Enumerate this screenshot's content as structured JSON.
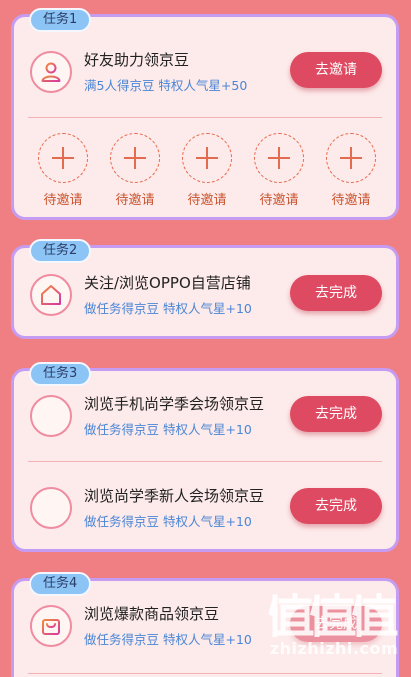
{
  "tasks": [
    {
      "tag": "任务1",
      "items": [
        {
          "title": "好友助力领京豆",
          "subtitle": "满5人得京豆 特权人气星+50",
          "button": "去邀请",
          "icon": "person-icon"
        }
      ],
      "invite_slots": [
        "待邀请",
        "待邀请",
        "待邀请",
        "待邀请",
        "待邀请"
      ]
    },
    {
      "tag": "任务2",
      "items": [
        {
          "title": "关注/浏览OPPO自营店铺",
          "subtitle": "做任务得京豆 特权人气星+10",
          "button": "去完成",
          "icon": "store-icon"
        }
      ]
    },
    {
      "tag": "任务3",
      "items": [
        {
          "title": "浏览手机尚学季会场领京豆",
          "subtitle": "做任务得京豆 特权人气星+10",
          "button": "去完成",
          "icon": "bars-icon"
        },
        {
          "title": "浏览尚学季新人会场领京豆",
          "subtitle": "做任务得京豆 特权人气星+10",
          "button": "去完成",
          "icon": "bars-icon"
        }
      ]
    },
    {
      "tag": "任务4",
      "items": [
        {
          "title": "浏览爆款商品领京豆",
          "subtitle": "做任务得京豆 特权人气星+10",
          "button": "去完成",
          "icon": "bag-icon"
        }
      ]
    }
  ],
  "watermark": {
    "text": "zhizhizhi.com",
    "glyphs": "值值值"
  },
  "colors": {
    "background": "#ef7f82",
    "card": "#fdeaea",
    "card_border": "#c69cf2",
    "tag": "#8cc4f6",
    "button": "#dd4a62",
    "subtitle": "#4a86d6",
    "invite_label": "#c9542f"
  }
}
